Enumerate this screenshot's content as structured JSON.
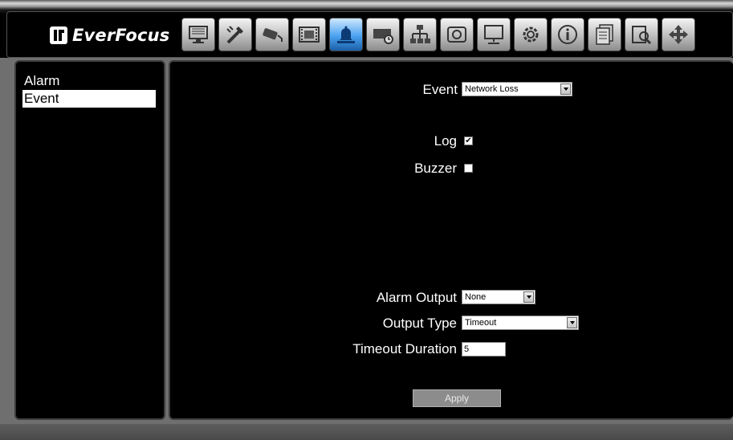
{
  "app": {
    "brand": "EverFocus"
  },
  "toolbar": {
    "buttons": [
      {
        "icon": "monitor-icon"
      },
      {
        "icon": "tools-icon"
      },
      {
        "icon": "camera-icon"
      },
      {
        "icon": "film-record-icon"
      },
      {
        "icon": "alarm-bell-icon",
        "active": true
      },
      {
        "icon": "storage-schedule-icon"
      },
      {
        "icon": "network-icon"
      },
      {
        "icon": "disk-icon"
      },
      {
        "icon": "display-icon"
      },
      {
        "icon": "gear-icon"
      },
      {
        "icon": "info-icon"
      },
      {
        "icon": "log-pages-icon"
      },
      {
        "icon": "search-icon"
      },
      {
        "icon": "ptz-arrows-icon"
      }
    ]
  },
  "sidebar": {
    "items": [
      {
        "label": "Alarm",
        "selected": false
      },
      {
        "label": "Event",
        "selected": true
      }
    ]
  },
  "form": {
    "event_label": "Event",
    "event_value": "Network Loss",
    "log_label": "Log",
    "log_checked": true,
    "buzzer_label": "Buzzer",
    "buzzer_checked": false,
    "alarm_output_label": "Alarm Output",
    "alarm_output_value": "None",
    "output_type_label": "Output Type",
    "output_type_value": "Timeout",
    "timeout_duration_label": "Timeout Duration",
    "timeout_duration_value": "5",
    "apply_label": "Apply"
  },
  "colors": {
    "active_tool": "#4aa2f0",
    "panel_bg": "#000000",
    "selected_item_bg": "#ffffff"
  }
}
